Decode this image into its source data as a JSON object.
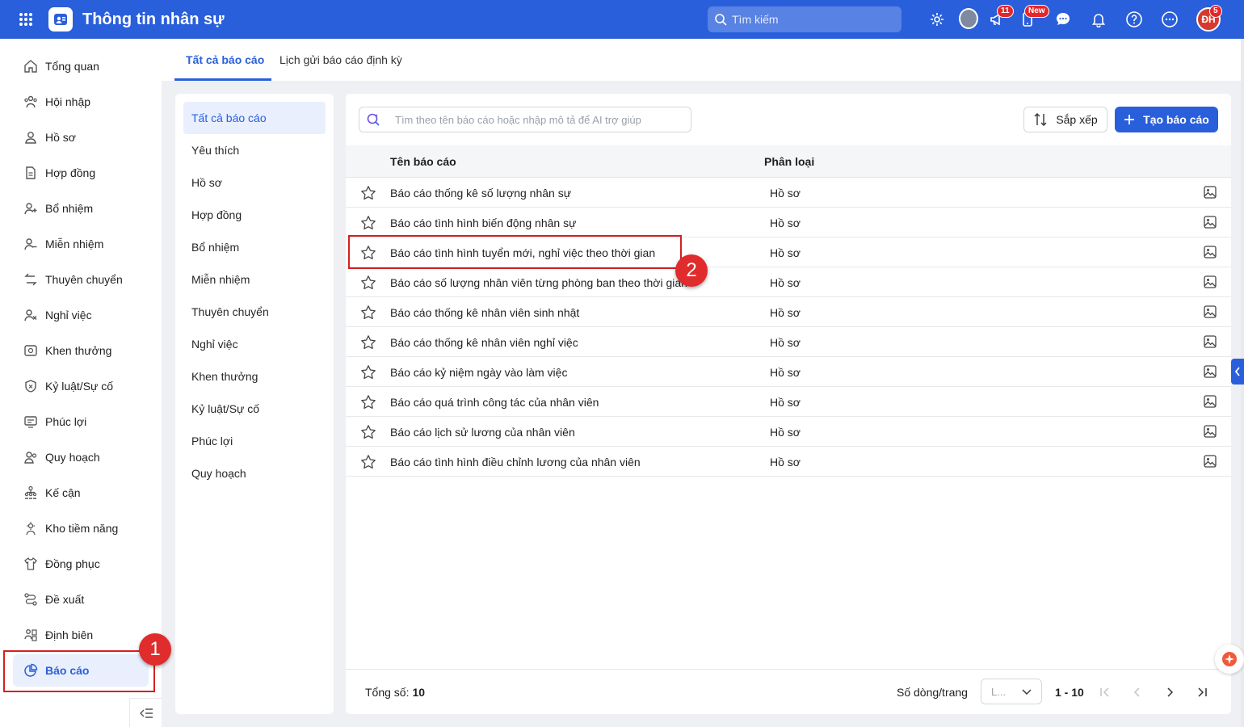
{
  "header": {
    "app_title": "Thông tin nhân sự",
    "search_placeholder": "Tìm kiếm",
    "announce_badge": "11",
    "mobile_badge": "New",
    "user_initials": "ĐH",
    "user_badge": "5"
  },
  "sidebar": {
    "items": [
      {
        "label": "Tổng quan",
        "icon": "home-icon"
      },
      {
        "label": "Hội nhập",
        "icon": "onboarding-icon"
      },
      {
        "label": "Hồ sơ",
        "icon": "user-icon"
      },
      {
        "label": "Hợp đồng",
        "icon": "contract-icon"
      },
      {
        "label": "Bổ nhiệm",
        "icon": "user-plus-icon"
      },
      {
        "label": "Miễn nhiệm",
        "icon": "user-minus-icon"
      },
      {
        "label": "Thuyên chuyển",
        "icon": "transfer-icon"
      },
      {
        "label": "Nghỉ việc",
        "icon": "user-x-icon"
      },
      {
        "label": "Khen thưởng",
        "icon": "reward-icon"
      },
      {
        "label": "Kỷ luật/Sự cố",
        "icon": "shield-icon"
      },
      {
        "label": "Phúc lợi",
        "icon": "benefit-icon"
      },
      {
        "label": "Quy hoạch",
        "icon": "planning-icon"
      },
      {
        "label": "Kế cận",
        "icon": "succession-icon"
      },
      {
        "label": "Kho tiềm năng",
        "icon": "talent-pool-icon"
      },
      {
        "label": "Đồng phục",
        "icon": "shirt-icon"
      },
      {
        "label": "Đề xuất",
        "icon": "proposal-icon"
      },
      {
        "label": "Định biên",
        "icon": "headcount-icon"
      },
      {
        "label": "Báo cáo",
        "icon": "report-pie-icon"
      }
    ]
  },
  "tabs": [
    {
      "label": "Tất cả báo cáo"
    },
    {
      "label": "Lịch gửi báo cáo định kỳ"
    }
  ],
  "categories": [
    "Tất cả báo cáo",
    "Yêu thích",
    "Hồ sơ",
    "Hợp đồng",
    "Bổ nhiệm",
    "Miễn nhiệm",
    "Thuyên chuyển",
    "Nghỉ việc",
    "Khen thưởng",
    "Kỷ luật/Sự cố",
    "Phúc lợi",
    "Quy hoạch"
  ],
  "main": {
    "search_placeholder": "Tìm theo tên báo cáo hoặc nhập mô tả để AI trợ giúp",
    "sort_label": "Sắp xếp",
    "create_label": "Tạo báo cáo",
    "col_name": "Tên báo cáo",
    "col_category": "Phân loại",
    "rows": [
      {
        "name": "Báo cáo thống kê số lượng nhân sự",
        "category": "Hồ sơ"
      },
      {
        "name": "Báo cáo tình hình biến động nhân sự",
        "category": "Hồ sơ"
      },
      {
        "name": "Báo cáo tình hình tuyển mới, nghỉ việc theo thời gian",
        "category": "Hồ sơ"
      },
      {
        "name": "Báo cáo số lượng nhân viên từng phòng ban theo thời gian",
        "category": "Hồ sơ"
      },
      {
        "name": "Báo cáo thống kê nhân viên sinh nhật",
        "category": "Hồ sơ"
      },
      {
        "name": "Báo cáo thống kê nhân viên nghỉ việc",
        "category": "Hồ sơ"
      },
      {
        "name": "Báo cáo kỷ niệm ngày vào làm việc",
        "category": "Hồ sơ"
      },
      {
        "name": "Báo cáo quá trình công tác của nhân viên",
        "category": "Hồ sơ"
      },
      {
        "name": "Báo cáo lịch sử lương của nhân viên",
        "category": "Hồ sơ"
      },
      {
        "name": "Báo cáo tình hình điều chỉnh lương của nhân viên",
        "category": "Hồ sơ"
      }
    ],
    "total_label": "Tổng số:",
    "total_value": "10",
    "rows_per_page_label": "Số dòng/trang",
    "rows_per_page_value": "L...",
    "range": "1 - 10"
  },
  "annotations": [
    "1",
    "2"
  ],
  "colors": {
    "primary": "#2a5fdb",
    "annotation": "#e02c2c"
  }
}
